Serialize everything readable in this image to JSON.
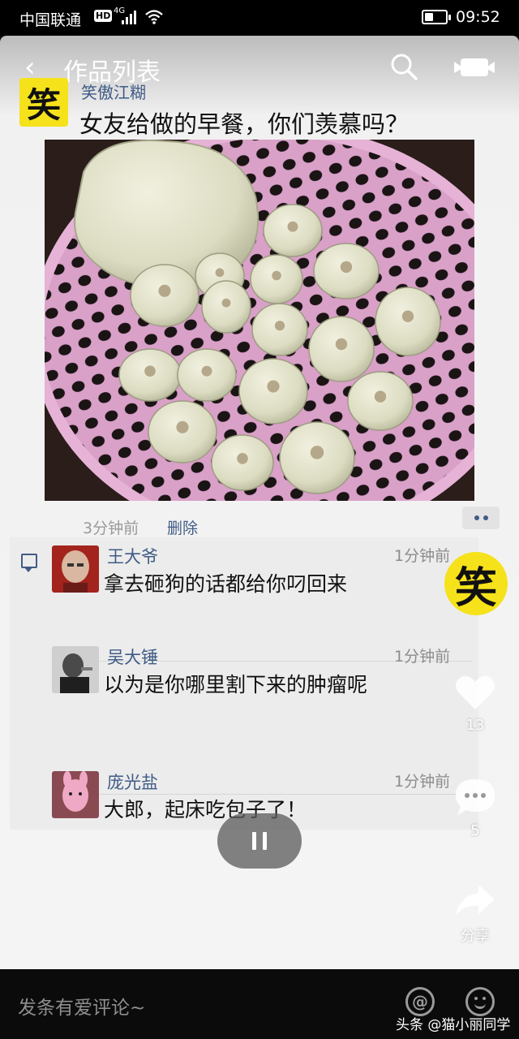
{
  "status_bar": {
    "carrier": "中国联通",
    "hd": "HD",
    "network": "4G",
    "battery_level": 0.4,
    "time": "09:52"
  },
  "nav": {
    "back_icon": "chevron-left",
    "title": "作品列表",
    "search_icon": "search",
    "camera_icon": "video-camera"
  },
  "post": {
    "author_logo": "笑",
    "author": "笑傲江糊",
    "title": "女友给做的早餐，你们羡慕吗？",
    "photo_icon": "steamed-buns-photo",
    "time": "3分钟前",
    "delete_label": "删除"
  },
  "comments": [
    {
      "name": "王大爷",
      "time": "1分钟前",
      "text": "拿去砸狗的话都给你叼回来"
    },
    {
      "name": "吴大锤",
      "time": "1分钟前",
      "text": "以为是你哪里割下来的肿瘤呢"
    },
    {
      "name": "庞光盐",
      "time": "1分钟前",
      "text": "大郎，起床吃包子了！"
    }
  ],
  "side": {
    "logo": "笑",
    "likes": "13",
    "comments": "5",
    "share_label": "分享"
  },
  "bottom": {
    "comment_placeholder": "发条有爱评论~",
    "at_icon": "@",
    "emoji_icon": "smiley",
    "watermark": "头条 @猫小丽同学"
  },
  "colors": {
    "link_blue": "#3f5b86",
    "logo_yellow": "#f5e21b",
    "basket_pink": "#d9a0c8"
  }
}
